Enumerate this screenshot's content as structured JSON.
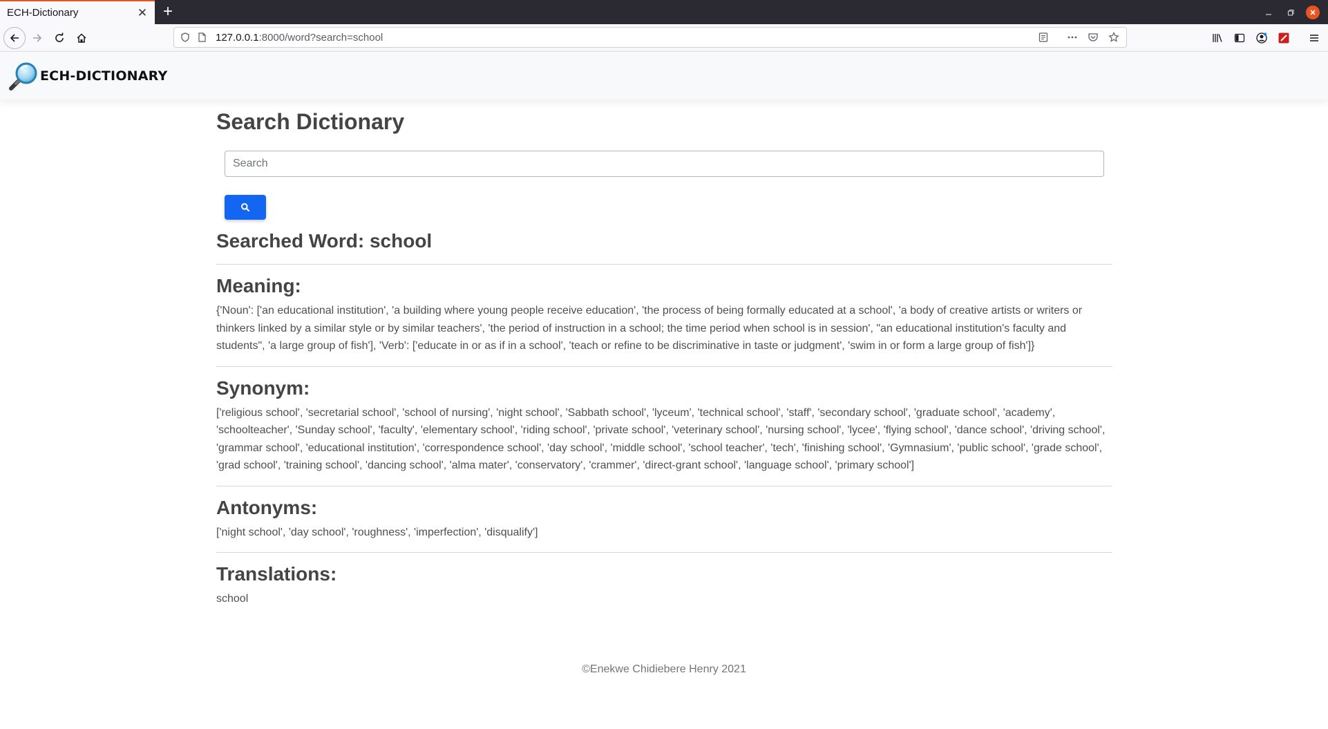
{
  "browser": {
    "tab_title": "ECH-Dictionary",
    "tab_close": "✕",
    "new_tab": "+",
    "url_host": "127.0.0.1",
    "url_rest": ":8000/word?search=school"
  },
  "header": {
    "brand": "ECH-DICTIONARY"
  },
  "search": {
    "title": "Search Dictionary",
    "placeholder": "Search"
  },
  "result": {
    "word_label": "Searched Word: school",
    "meaning_title": "Meaning:",
    "meaning_text": "{'Noun': ['an educational institution', 'a building where young people receive education', 'the process of being formally educated at a school', 'a body of creative artists or writers or thinkers linked by a similar style or by similar teachers', 'the period of instruction in a school; the time period when school is in session', \"an educational institution's faculty and students\", 'a large group of fish'], 'Verb': ['educate in or as if in a school', 'teach or refine to be discriminative in taste or judgment', 'swim in or form a large group of fish']}",
    "synonym_title": "Synonym:",
    "synonym_text": "['religious school', 'secretarial school', 'school of nursing', 'night school', 'Sabbath school', 'lyceum', 'technical school', 'staff', 'secondary school', 'graduate school', 'academy', 'schoolteacher', 'Sunday school', 'faculty', 'elementary school', 'riding school', 'private school', 'veterinary school', 'nursing school', 'lycee', 'flying school', 'dance school', 'driving school', 'grammar school', 'educational institution', 'correspondence school', 'day school', 'middle school', 'school teacher', 'tech', 'finishing school', 'Gymnasium', 'public school', 'grade school', 'grad school', 'training school', 'dancing school', 'alma mater', 'conservatory', 'crammer', 'direct-grant school', 'language school', 'primary school']",
    "antonym_title": "Antonyms:",
    "antonym_text": "['night school', 'day school', 'roughness', 'imperfection', 'disqualify']",
    "translation_title": "Translations:",
    "translation_text": "school"
  },
  "footer": {
    "copyright": "©Enekwe Chidiebere Henry 2021"
  },
  "colors": {
    "accent": "#1266f1",
    "tab_accent": "#e25920",
    "window_close": "#e95420"
  }
}
